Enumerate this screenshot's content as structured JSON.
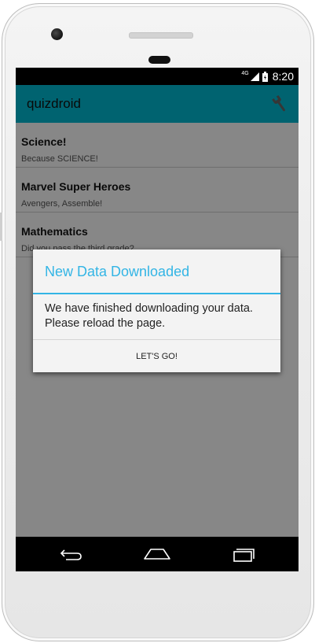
{
  "status_bar": {
    "network_label": "4G",
    "time": "8:20",
    "icons": [
      "signal-icon",
      "battery-icon"
    ]
  },
  "app_bar": {
    "title": "quizdroid",
    "settings_icon": "wrench-icon"
  },
  "quiz_list": [
    {
      "title": "Science!",
      "description": "Because SCIENCE!"
    },
    {
      "title": "Marvel Super Heroes",
      "description": "Avengers, Assemble!"
    },
    {
      "title": "Mathematics",
      "description": "Did you pass the third grade?"
    }
  ],
  "dialog": {
    "title": "New Data Downloaded",
    "message": "We have finished downloading your data. Please reload the page.",
    "button_label": "LET'S GO!"
  },
  "nav_bar": {
    "icons": [
      "back-icon",
      "home-icon",
      "recent-apps-icon"
    ]
  },
  "colors": {
    "app_bar": "#00bcd4",
    "dialog_accent": "#33b5e5",
    "status_bar": "#000000",
    "nav_bar": "#000000"
  }
}
